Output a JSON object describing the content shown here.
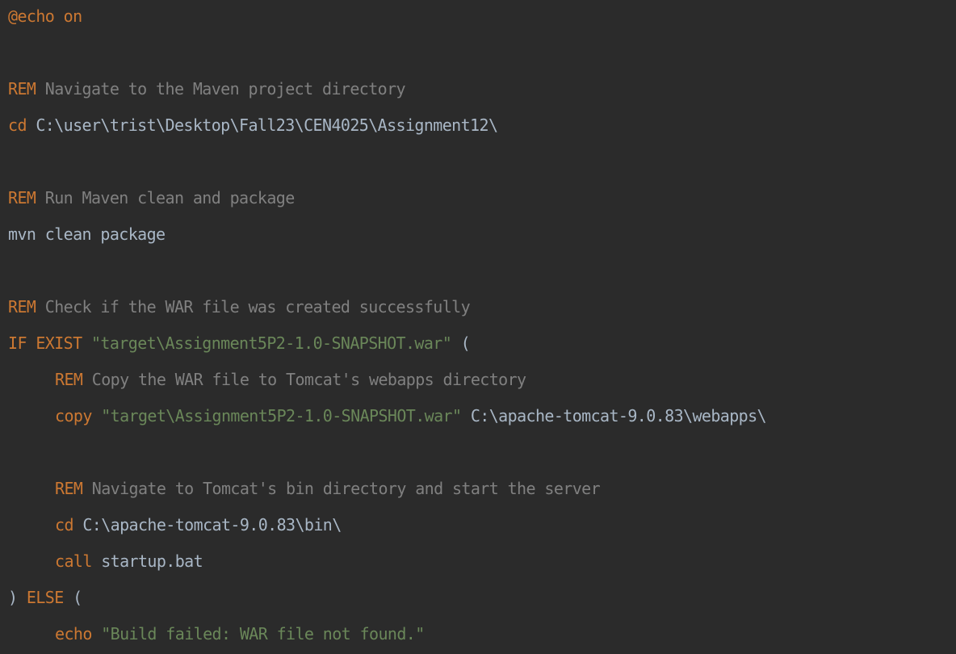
{
  "editor": {
    "lines": [
      [
        {
          "type": "keyword",
          "text": "@echo on"
        }
      ],
      [],
      [
        {
          "type": "keyword",
          "text": "REM"
        },
        {
          "type": "comment",
          "text": " Navigate to the Maven project directory"
        }
      ],
      [
        {
          "type": "keyword",
          "text": "cd"
        },
        {
          "type": "plain",
          "text": " C:\\user\\trist\\Desktop\\Fall23\\CEN4025\\Assignment12\\"
        }
      ],
      [],
      [
        {
          "type": "keyword",
          "text": "REM"
        },
        {
          "type": "comment",
          "text": " Run Maven clean and package"
        }
      ],
      [
        {
          "type": "plain",
          "text": "mvn clean package"
        }
      ],
      [],
      [
        {
          "type": "keyword",
          "text": "REM"
        },
        {
          "type": "comment",
          "text": " Check if the WAR file was created successfully"
        }
      ],
      [
        {
          "type": "keyword",
          "text": "IF EXIST"
        },
        {
          "type": "plain",
          "text": " "
        },
        {
          "type": "string",
          "text": "\"target\\Assignment5P2-1.0-SNAPSHOT.war\""
        },
        {
          "type": "plain",
          "text": " ("
        }
      ],
      [
        {
          "type": "indent",
          "text": ""
        },
        {
          "type": "keyword",
          "text": "REM"
        },
        {
          "type": "comment",
          "text": " Copy the WAR file to Tomcat's webapps directory"
        }
      ],
      [
        {
          "type": "indent",
          "text": ""
        },
        {
          "type": "keyword",
          "text": "copy"
        },
        {
          "type": "plain",
          "text": " "
        },
        {
          "type": "string",
          "text": "\"target\\Assignment5P2-1.0-SNAPSHOT.war\""
        },
        {
          "type": "plain",
          "text": " C:\\apache-tomcat-9.0.83\\webapps\\"
        }
      ],
      [],
      [
        {
          "type": "indent",
          "text": ""
        },
        {
          "type": "keyword",
          "text": "REM"
        },
        {
          "type": "comment",
          "text": " Navigate to Tomcat's bin directory and start the server"
        }
      ],
      [
        {
          "type": "indent",
          "text": ""
        },
        {
          "type": "keyword",
          "text": "cd"
        },
        {
          "type": "plain",
          "text": " C:\\apache-tomcat-9.0.83\\bin\\"
        }
      ],
      [
        {
          "type": "indent",
          "text": ""
        },
        {
          "type": "keyword",
          "text": "call"
        },
        {
          "type": "plain",
          "text": " startup.bat"
        }
      ],
      [
        {
          "type": "plain",
          "text": ") "
        },
        {
          "type": "keyword",
          "text": "ELSE"
        },
        {
          "type": "plain",
          "text": " ("
        }
      ],
      [
        {
          "type": "indent",
          "text": ""
        },
        {
          "type": "keyword",
          "text": "echo"
        },
        {
          "type": "plain",
          "text": " "
        },
        {
          "type": "string",
          "text": "\"Build failed: WAR file not found.\""
        }
      ],
      [
        {
          "type": "plain",
          "text": ")"
        }
      ]
    ]
  },
  "colors": {
    "background": "#2b2b2b",
    "keyword": "#cc7832",
    "comment": "#808080",
    "string": "#6a8759",
    "plain": "#a9b7c6"
  }
}
